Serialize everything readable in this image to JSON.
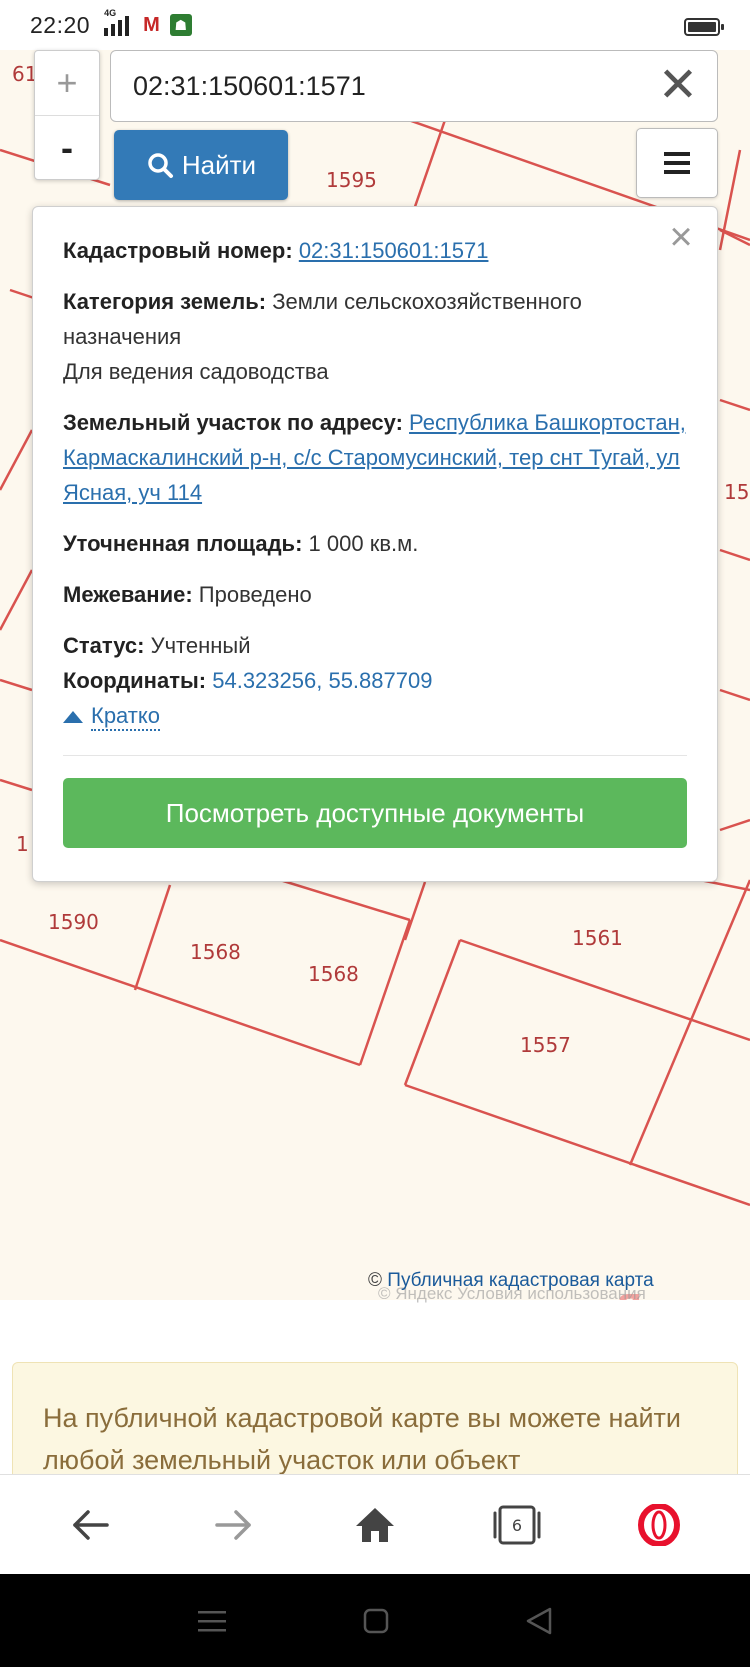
{
  "status_bar": {
    "time": "22:20",
    "network": "4G",
    "mail_icon": "gmail-icon",
    "notification_icon": "app-notification-icon"
  },
  "map": {
    "parcel_labels": [
      "61",
      "1595",
      "1590",
      "1568",
      "1568",
      "1561",
      "1557",
      "15",
      "1"
    ],
    "zoom_in_label": "+",
    "zoom_out_label": "-"
  },
  "search": {
    "value": "02:31:150601:1571",
    "clear_label": "✕",
    "find_label": "Найти",
    "menu_icon": "hamburger-menu-icon"
  },
  "popup": {
    "cadastral_label": "Кадастровый номер:",
    "cadastral_value": "02:31:150601:1571",
    "category_label": "Категория земель:",
    "category_value": "Земли сельскохозяйственного назначения",
    "usage_value": "Для ведения садоводства",
    "address_label": "Земельный участок по адресу:",
    "address_value": "Республика Башкортостан, Кармаскалинский р-н, с/с Старомусинский, тер снт Тугай, ул Ясная, уч 114",
    "area_label": "Уточненная площадь:",
    "area_value": "1 000 кв.м.",
    "survey_label": "Межевание:",
    "survey_value": "Проведено",
    "status_label": "Статус:",
    "status_value": "Учтенный",
    "coords_label": "Координаты:",
    "coords_value": "54.323256, 55.887709",
    "brief_label": "Кратко",
    "docs_button": "Посмотреть доступные документы",
    "close_label": "×"
  },
  "attribution": {
    "copyright": "©",
    "link": "Публичная кадастровая карта",
    "yandex_logo": "Яндекс",
    "yandex_terms": "© Яндекс  Условия использования"
  },
  "info_banner": {
    "text": "На публичной кадастровой карте вы можете найти любой земельный участок или объект"
  },
  "browser_bar": {
    "tabs_count": "6"
  },
  "colors": {
    "parcel_line": "#d9534f",
    "map_bg": "#fdf8ee",
    "primary_blue": "#337ab7",
    "success_green": "#5cb85c",
    "link_blue": "#2a6fad",
    "opera_red": "#e8112d"
  }
}
